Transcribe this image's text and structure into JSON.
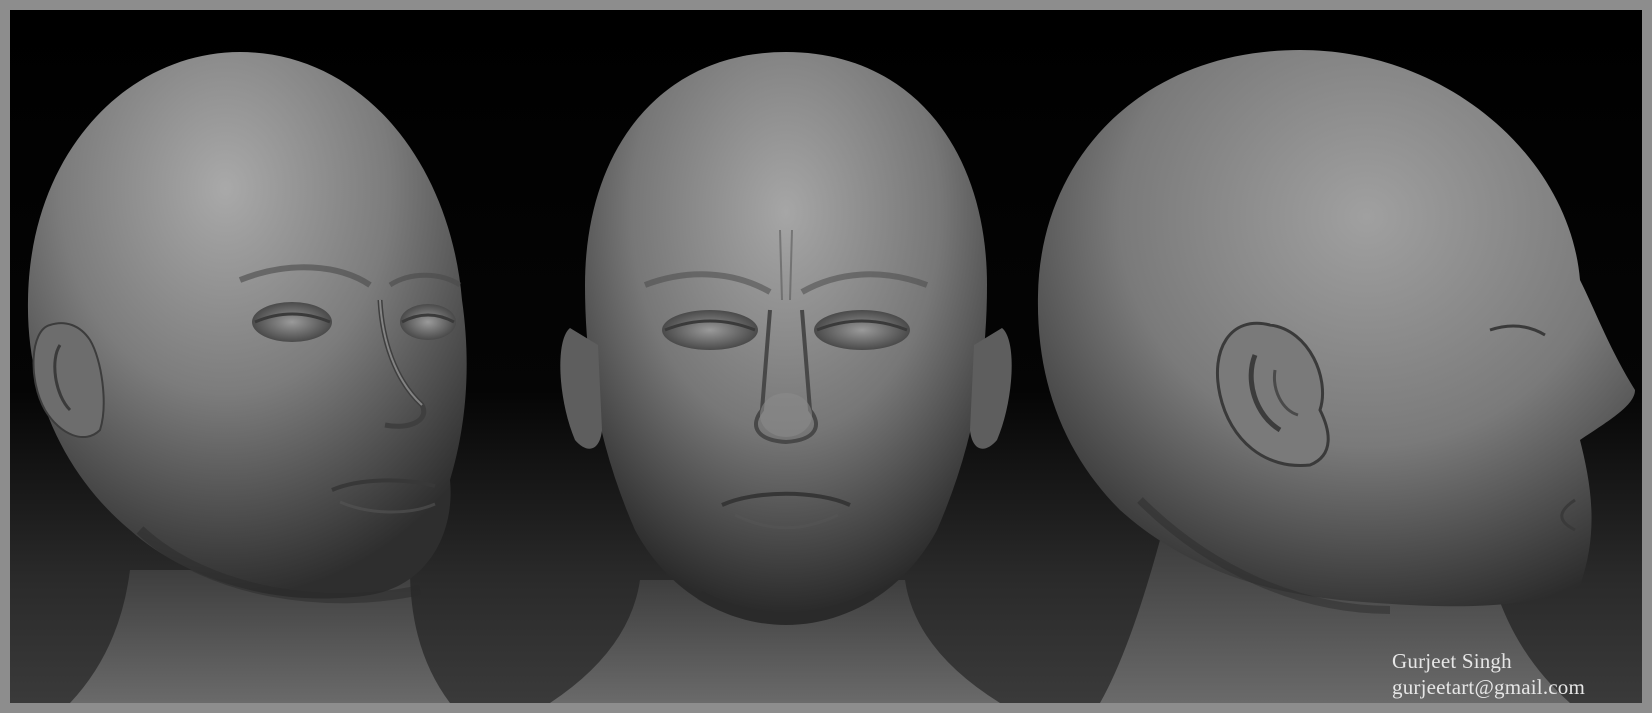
{
  "signature": {
    "name": "Gurjeet Singh",
    "email": "gurjeetart@gmail.com"
  },
  "colors": {
    "frame": "#8d8d8d",
    "background": "#050505",
    "clay": "#7a7a7a",
    "signature_text": "#e6e6e6"
  },
  "views": [
    "three-quarter-left",
    "front",
    "profile-right"
  ]
}
